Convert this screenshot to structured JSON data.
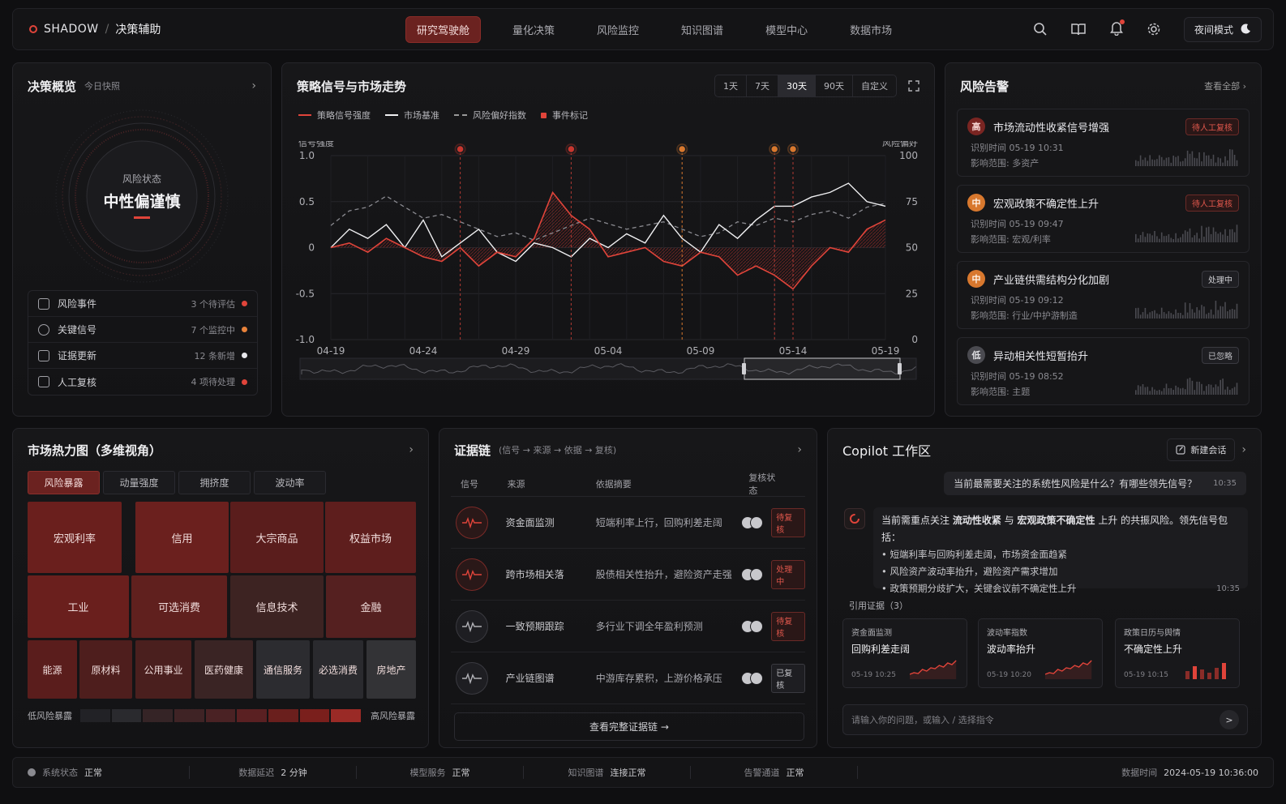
{
  "topbar": {
    "brand": "SHADOW",
    "separator": "/",
    "module": "决策辅助",
    "tabs": [
      "研究驾驶舱",
      "量化决策",
      "风险监控",
      "知识图谱",
      "模型中心",
      "数据市场"
    ],
    "night_mode": "夜间模式"
  },
  "overview": {
    "title": "决策概览",
    "subtitle": "今日快照",
    "gauge_label": "风险状态",
    "gauge_value": "中性偏谨慎",
    "items": [
      {
        "label": "风险事件",
        "count": "3 个待评估",
        "color": "#e0443a"
      },
      {
        "label": "关键信号",
        "count": "7 个监控中",
        "color": "#e8823a"
      },
      {
        "label": "证据更新",
        "count": "12 条新增",
        "color": "#e8e8ec"
      },
      {
        "label": "人工复核",
        "count": "4 项待处理",
        "color": "#e0443a"
      }
    ]
  },
  "signals": {
    "title": "策略信号与市场走势",
    "ranges": [
      "1天",
      "7天",
      "30天",
      "90天",
      "自定义"
    ],
    "selected_range": "30天",
    "legend": [
      "策略信号强度",
      "市场基准",
      "风险偏好指数",
      "事件标记"
    ],
    "left_axis_title": "信号强度",
    "right_axis_title": "风险偏好"
  },
  "chart_data": {
    "type": "line",
    "ylabel": "信号强度",
    "y2label": "风险偏好",
    "ylim": [
      -1.0,
      1.0
    ],
    "y2lim": [
      0,
      100
    ],
    "yticks": [
      "1.0",
      "0.5",
      "0",
      "-0.5",
      "-1.0"
    ],
    "y2ticks": [
      "100",
      "75",
      "50",
      "25",
      "0"
    ],
    "xticks": [
      "04-19",
      "04-24",
      "04-29",
      "05-04",
      "05-09",
      "05-14",
      "05-19"
    ],
    "x": [
      "04-19",
      "04-20",
      "04-21",
      "04-22",
      "04-23",
      "04-24",
      "04-25",
      "04-26",
      "04-27",
      "04-28",
      "04-29",
      "04-30",
      "05-01",
      "05-02",
      "05-03",
      "05-04",
      "05-05",
      "05-06",
      "05-07",
      "05-08",
      "05-09",
      "05-10",
      "05-11",
      "05-12",
      "05-13",
      "05-14",
      "05-15",
      "05-16",
      "05-17",
      "05-18",
      "05-19"
    ],
    "series": [
      {
        "name": "策略信号强度",
        "values": [
          0.0,
          0.05,
          -0.05,
          0.1,
          0.0,
          -0.1,
          -0.15,
          0.0,
          -0.2,
          -0.05,
          -0.1,
          0.1,
          0.6,
          0.35,
          0.2,
          -0.1,
          -0.05,
          0.0,
          -0.15,
          -0.2,
          -0.05,
          -0.1,
          -0.3,
          -0.2,
          -0.3,
          -0.45,
          -0.2,
          0.0,
          -0.05,
          0.2,
          0.3
        ]
      },
      {
        "name": "市场基准",
        "values": [
          0.0,
          0.2,
          0.1,
          0.25,
          0.0,
          0.3,
          -0.1,
          0.05,
          0.2,
          -0.05,
          -0.15,
          0.05,
          0.0,
          -0.1,
          0.1,
          0.0,
          0.15,
          0.05,
          0.35,
          0.1,
          -0.05,
          0.25,
          0.1,
          0.3,
          0.45,
          0.45,
          0.55,
          0.6,
          0.7,
          0.5,
          0.45
        ]
      },
      {
        "name": "风险偏好指数",
        "values": [
          62,
          70,
          72,
          78,
          72,
          66,
          68,
          64,
          60,
          56,
          58,
          54,
          58,
          62,
          66,
          63,
          60,
          62,
          64,
          60,
          56,
          58,
          64,
          62,
          66,
          64,
          68,
          70,
          66,
          72,
          74
        ]
      }
    ],
    "events": [
      "04-26",
      "05-02",
      "05-08",
      "05-13",
      "05-14"
    ]
  },
  "alerts": {
    "title": "风险告警",
    "view_all": "查看全部",
    "items": [
      {
        "level": "高",
        "name": "市场流动性收紧信号增强",
        "status": "待人工复核",
        "time": "识别时间  05-19 10:31",
        "scope": "影响范围:  多资产"
      },
      {
        "level": "中",
        "name": "宏观政策不确定性上升",
        "status": "待人工复核",
        "time": "识别时间  05-19 09:47",
        "scope": "影响范围:  宏观/利率"
      },
      {
        "level": "中",
        "name": "产业链供需结构分化加剧",
        "status": "处理中",
        "time": "识别时间  05-19 09:12",
        "scope": "影响范围:  行业/中护游制造"
      },
      {
        "level": "低",
        "name": "异动相关性短暂抬升",
        "status": "已忽略",
        "time": "识别时间  05-19 08:52",
        "scope": "影响范围:  主题"
      }
    ]
  },
  "heatmap": {
    "title": "市场热力图（多维视角）",
    "tabs": [
      "风险暴露",
      "动量强度",
      "拥挤度",
      "波动率"
    ],
    "row1": [
      "宏观利率",
      "信用",
      "大宗商品",
      "权益市场"
    ],
    "row2": [
      "工业",
      "可选消费",
      "信息技术",
      "金融"
    ],
    "row3": [
      "能源",
      "原材料",
      "公用事业",
      "医药健康",
      "通信服务",
      "必选消费",
      "房地产"
    ],
    "low_label": "低风险暴露",
    "high_label": "高风险暴露"
  },
  "evidence": {
    "title": "证据链",
    "flow": "(信号 → 来源 → 依据 → 复核)",
    "headers": [
      "信号",
      "来源",
      "依据摘要",
      "复核状态"
    ],
    "rows": [
      {
        "source": "资金面监测",
        "summary": "短端利率上行，回购利差走阔",
        "status": "待复核"
      },
      {
        "source": "跨市场相关落",
        "summary": "股债相关性抬升，避险资产走强",
        "status": "处理中"
      },
      {
        "source": "一致预期跟踪",
        "summary": "多行业下调全年盈利预测",
        "status": "待复核"
      },
      {
        "source": "产业链图谱",
        "summary": "中游库存累积，上游价格承压",
        "status": "已复核"
      }
    ],
    "view_full": "查看完整证据链"
  },
  "copilot": {
    "title": "Copilot 工作区",
    "new_session": "新建会话",
    "user_msg": "当前最需要关注的系统性风险是什么？有哪些领先信号？",
    "user_time": "10:35",
    "bot_pre": "当前需重点关注 ",
    "bot_k1": "流动性收紧",
    "bot_mid": " 与 ",
    "bot_k2": "宏观政策不确定性",
    "bot_post": " 上升 的共振风险。领先信号包括：",
    "bullets": [
      "短端利率与回购利差走阔，市场资金面趋紧",
      "风险资产波动率抬升，避险资产需求增加",
      "政策预期分歧扩大，关键会议前不确定性上升"
    ],
    "bot_time": "10:35",
    "refs_title": "引用证据（3）",
    "refs": [
      {
        "cat": "资金面监测",
        "name": "回购利差走阔",
        "time": "05-19 10:25"
      },
      {
        "cat": "波动率指数",
        "name": "波动率抬升",
        "time": "05-19 10:20"
      },
      {
        "cat": "政策日历与舆情",
        "name": "不确定性上升",
        "time": "05-19 10:15"
      }
    ],
    "placeholder": "请输入你的问题，或输入 / 选择指令"
  },
  "footer": {
    "items": [
      {
        "label": "系统状态",
        "value": "正常"
      },
      {
        "label": "数据延迟",
        "value": "2 分钟"
      },
      {
        "label": "模型服务",
        "value": "正常"
      },
      {
        "label": "知识图谱",
        "value": "连接正常"
      },
      {
        "label": "告警通道",
        "value": "正常"
      }
    ],
    "data_time_label": "数据时间",
    "data_time": "2024-05-19 10:36:00"
  }
}
